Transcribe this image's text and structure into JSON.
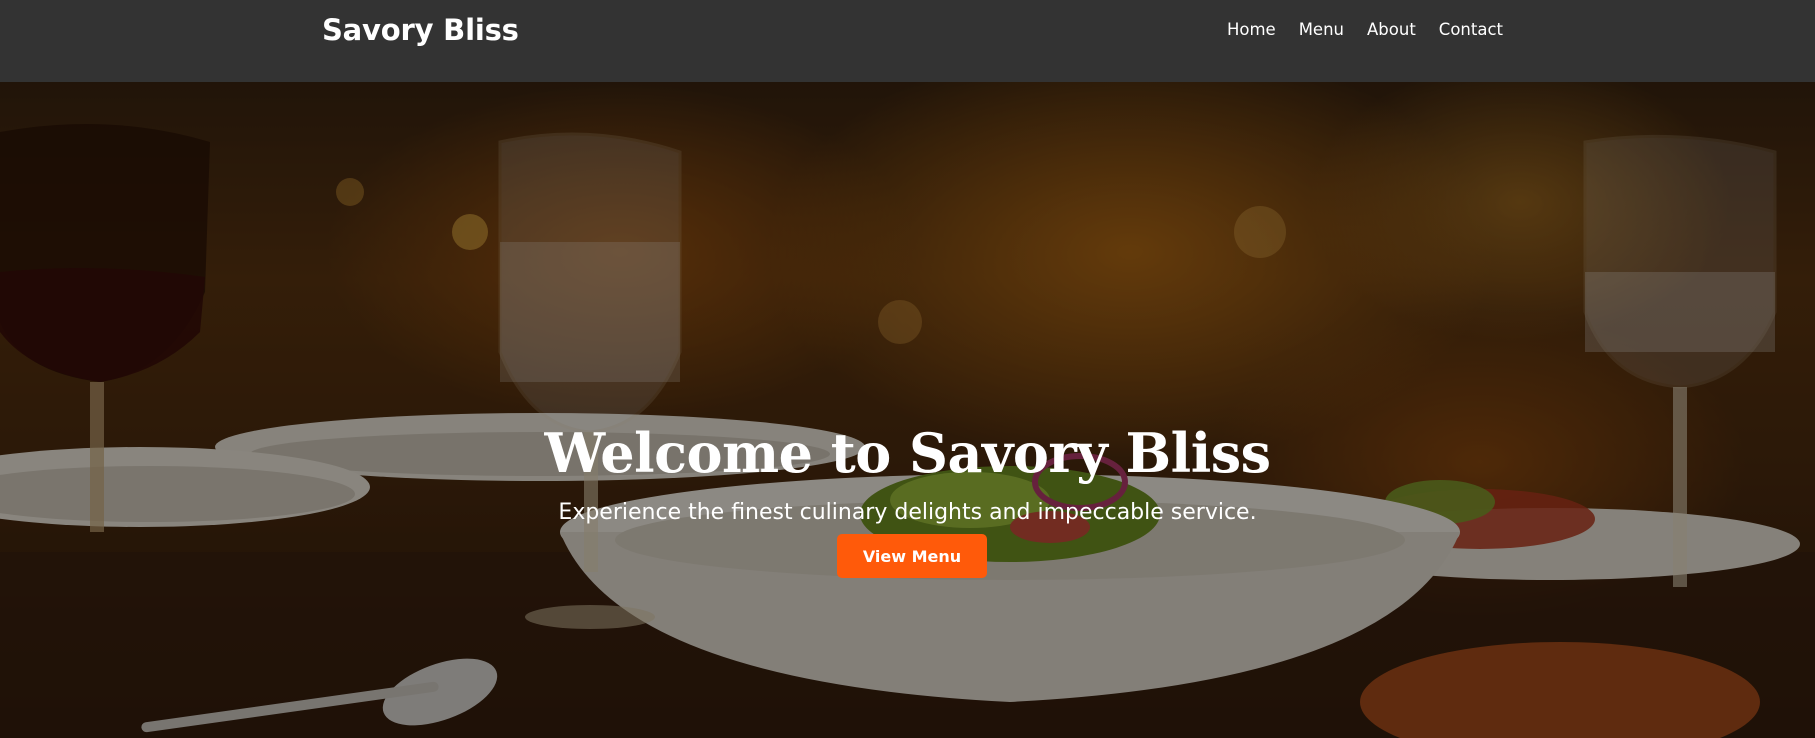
{
  "header": {
    "brand": "Savory Bliss",
    "nav": [
      "Home",
      "Menu",
      "About",
      "Contact"
    ]
  },
  "hero": {
    "title": "Welcome to Savory Bliss",
    "subtitle": "Experience the finest culinary delights and impeccable service.",
    "cta_label": "View Menu"
  },
  "colors": {
    "header_bg": "#333333",
    "accent": "#ff5a0a",
    "text": "#ffffff"
  }
}
